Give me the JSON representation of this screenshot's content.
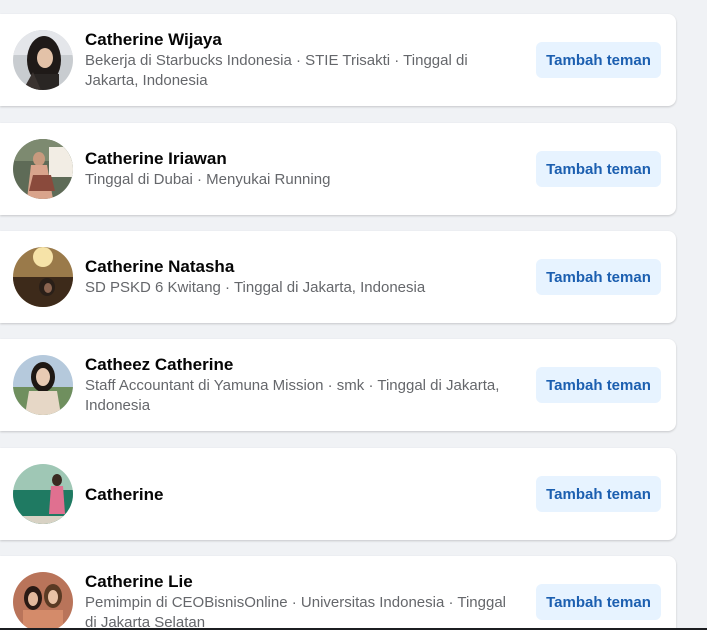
{
  "results": [
    {
      "name": "Catherine Wijaya",
      "desc": "Bekerja di Starbucks Indonesia · STIE Trisakti · Tinggal di Jakarta, Indonesia",
      "button_label": "Tambah teman",
      "avatar_icon": "profile-photo"
    },
    {
      "name": "Catherine Iriawan",
      "desc": "Tinggal di Dubai · Menyukai Running",
      "button_label": "Tambah teman",
      "avatar_icon": "profile-photo"
    },
    {
      "name": "Catherine Natasha",
      "desc": "SD PSKD 6 Kwitang · Tinggal di Jakarta, Indonesia",
      "button_label": "Tambah teman",
      "avatar_icon": "profile-photo"
    },
    {
      "name": "Catheez Catherine",
      "desc": "Staff Accountant di Yamuna Mission · smk · Tinggal di Jakarta, Indonesia",
      "button_label": "Tambah teman",
      "avatar_icon": "profile-photo"
    },
    {
      "name": "Catherine",
      "desc": "",
      "button_label": "Tambah teman",
      "avatar_icon": "profile-photo"
    },
    {
      "name": "Catherine Lie",
      "desc": "Pemimpin di CEOBisnisOnline · Universitas Indonesia · Tinggal di Jakarta Selatan",
      "button_label": "Tambah teman",
      "avatar_icon": "profile-photo"
    }
  ],
  "colors": {
    "page_bg": "#f0f2f5",
    "card_bg": "#ffffff",
    "button_bg": "#e7f3ff",
    "button_text": "#1c5fb0",
    "name_text": "#050505",
    "meta_text": "#65676b"
  }
}
